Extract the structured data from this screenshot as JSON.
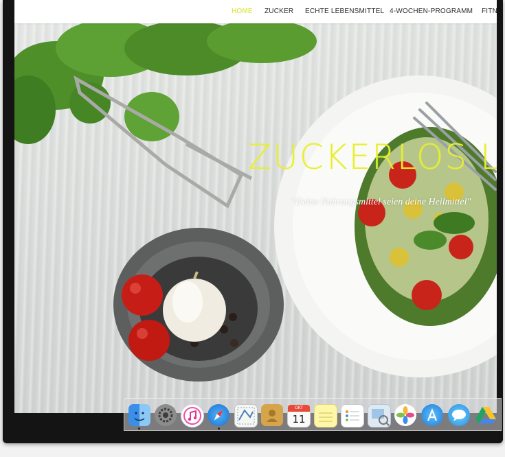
{
  "navbar": {
    "items": [
      {
        "label": "HOME",
        "active": true
      },
      {
        "label": "ZUCKER",
        "active": false
      },
      {
        "label": "ECHTE LEBENSMITTEL",
        "active": false
      },
      {
        "label": "4-WOCHEN-PROGRAMM",
        "active": false
      },
      {
        "label": "FITN",
        "active": false
      }
    ],
    "accent_color": "#d7e21c"
  },
  "hero": {
    "title": "ZUCKERLOS L",
    "subtitle": "\"Deine Nahrungsmittel seien deine Heilmittel\""
  },
  "dock": {
    "items": [
      {
        "name": "finder-icon",
        "running": true
      },
      {
        "name": "system-preferences-icon",
        "running": false
      },
      {
        "name": "itunes-icon",
        "running": false
      },
      {
        "name": "safari-icon",
        "running": true
      },
      {
        "name": "mail-icon",
        "running": false
      },
      {
        "name": "contacts-icon",
        "running": false
      },
      {
        "name": "calendar-icon",
        "running": false,
        "month": "OKT",
        "day": "11"
      },
      {
        "name": "notes-icon",
        "running": false
      },
      {
        "name": "reminders-icon",
        "running": false
      },
      {
        "name": "preview-icon",
        "running": false
      },
      {
        "name": "photos-icon",
        "running": false
      },
      {
        "name": "app-store-icon",
        "running": false
      },
      {
        "name": "messages-icon",
        "running": false
      },
      {
        "name": "google-drive-icon",
        "running": false
      }
    ]
  }
}
